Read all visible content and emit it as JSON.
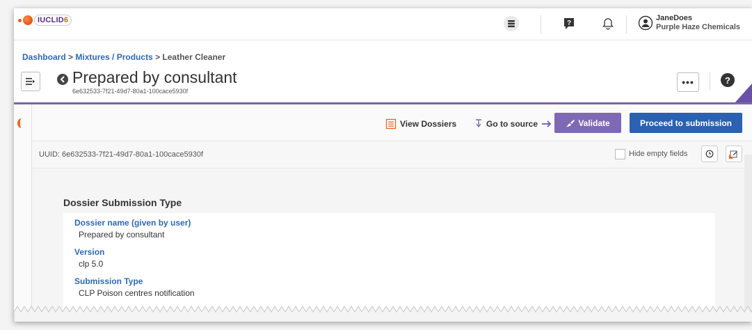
{
  "app": {
    "logo_text": "IUCLID",
    "logo_version": "6"
  },
  "user": {
    "name": "JaneDoes",
    "organisation": "Purple Haze Chemicals"
  },
  "breadcrumb": {
    "dashboard": "Dashboard",
    "sep1": " > ",
    "mixtures": "Mixtures / Products",
    "sep2": " > ",
    "current": "Leather Cleaner"
  },
  "page": {
    "title": "Prepared by consultant",
    "subtitle": "6e632533-7f21-49d7-80a1-100cace5930f",
    "more_label": "•••",
    "help_label": "?"
  },
  "toolbar": {
    "view_dossiers": "View Dossiers",
    "go_to_source": "Go to source",
    "validate": "Validate",
    "proceed": "Proceed to submission"
  },
  "uuid_bar": {
    "uuid_text": "UUID: 6e632533-7f21-49d7-80a1-100cace5930f",
    "hide_empty_label": "Hide empty fields",
    "hide_empty_checked": false
  },
  "section": {
    "title": "Dossier Submission Type",
    "fields": [
      {
        "label": "Dossier name (given by user)",
        "value": "Prepared by consultant"
      },
      {
        "label": "Version",
        "value": "clp 5.0"
      },
      {
        "label": "Submission Type",
        "value": "CLP Poison centres notification"
      }
    ]
  },
  "colors": {
    "accent_purple": "#7e69b5",
    "primary_blue": "#2a61b1",
    "link_blue": "#2f6ab0",
    "logo_orange": "#e05a1b"
  }
}
